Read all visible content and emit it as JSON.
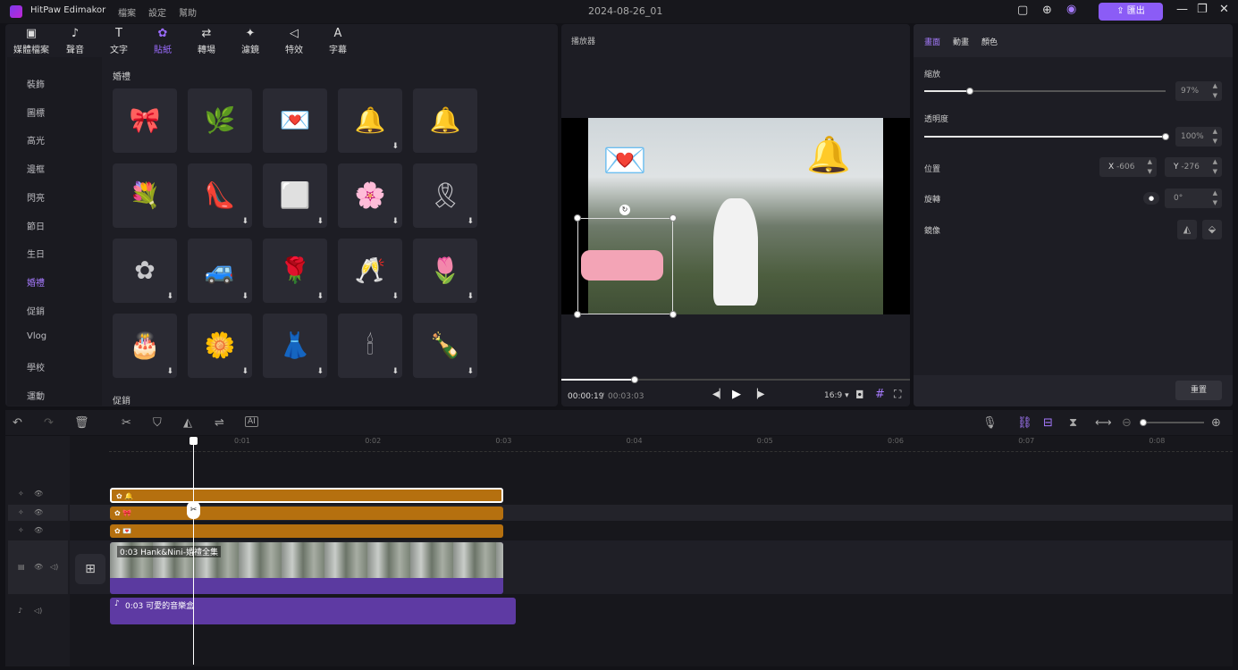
{
  "app": {
    "title": "HitPaw Edimakor",
    "project_date": "2024-08-26_01",
    "export_label": "匯出"
  },
  "menu": [
    "檔案",
    "設定",
    "幫助"
  ],
  "toolbar_tabs": [
    {
      "label": "媒體檔案",
      "icon": "media-icon"
    },
    {
      "label": "聲音",
      "icon": "music-note-icon"
    },
    {
      "label": "文字",
      "icon": "text-icon"
    },
    {
      "label": "貼紙",
      "icon": "sticker-icon",
      "active": true
    },
    {
      "label": "轉場",
      "icon": "transition-icon"
    },
    {
      "label": "濾鏡",
      "icon": "filter-icon"
    },
    {
      "label": "特效",
      "icon": "effects-icon"
    },
    {
      "label": "字幕",
      "icon": "subtitle-icon"
    }
  ],
  "categories": [
    "裝飾",
    "圖標",
    "高光",
    "邊框",
    "閃亮",
    "節日",
    "生日",
    "婚禮",
    "促銷",
    "Vlog",
    "學校",
    "運動"
  ],
  "active_category": "婚禮",
  "sticker_section_title": "婚禮",
  "next_section_title": "促銷",
  "stickers": [
    {
      "name": "floral-banner",
      "glyph": "🎀",
      "download": false
    },
    {
      "name": "floral-wreath",
      "glyph": "🌿",
      "download": false
    },
    {
      "name": "love-letters",
      "glyph": "💌",
      "download": false
    },
    {
      "name": "pink-bells",
      "glyph": "🔔",
      "download": true
    },
    {
      "name": "golden-bells",
      "glyph": "🔔",
      "download": false
    },
    {
      "name": "bouquet",
      "glyph": "💐",
      "download": false
    },
    {
      "name": "pink-heels",
      "glyph": "👠",
      "download": true
    },
    {
      "name": "white-card",
      "glyph": "⬜",
      "download": true
    },
    {
      "name": "pink-floral-banner",
      "glyph": "🌸",
      "download": true
    },
    {
      "name": "wedding-ribbon",
      "glyph": "🎗",
      "download": true
    },
    {
      "name": "white-flowers",
      "glyph": "✿",
      "download": true
    },
    {
      "name": "wedding-car",
      "glyph": "🚙",
      "download": true
    },
    {
      "name": "pink-roses",
      "glyph": "🌹",
      "download": true
    },
    {
      "name": "champagne-toast",
      "glyph": "🥂",
      "download": true
    },
    {
      "name": "single-rose",
      "glyph": "🌷",
      "download": true
    },
    {
      "name": "wedding-cake",
      "glyph": "🎂",
      "download": true
    },
    {
      "name": "white-rose",
      "glyph": "🌼",
      "download": true
    },
    {
      "name": "wedding-dress",
      "glyph": "👗",
      "download": true
    },
    {
      "name": "candle-flowers",
      "glyph": "🕯",
      "download": true
    },
    {
      "name": "champagne-bottle",
      "glyph": "🍾",
      "download": true
    }
  ],
  "player": {
    "title": "播放器",
    "current_time": "00:00:19",
    "separator": "/",
    "total_time": "00:03:03",
    "aspect": "16:9",
    "progress_fraction": 0.21
  },
  "props": {
    "tabs": [
      "畫面",
      "動畫",
      "顏色"
    ],
    "active_tab": "畫面",
    "scale_label": "縮放",
    "scale_value": "97%",
    "scale_fraction": 0.19,
    "opacity_label": "透明度",
    "opacity_value": "100%",
    "opacity_fraction": 1.0,
    "position_label": "位置",
    "pos_x_label": "X",
    "pos_x": "-606",
    "pos_y_label": "Y",
    "pos_y": "-276",
    "rotate_label": "旋轉",
    "rotate_value": "0°",
    "mirror_label": "鏡像",
    "reset_label": "重置"
  },
  "timeline": {
    "ruler": [
      "0:01",
      "0:02",
      "0:03",
      "0:04",
      "0:05",
      "0:06",
      "0:07",
      "0:08"
    ],
    "video_clip_label": "0:03 Hank&Nini-婚禮全集",
    "audio_clip_label": "0:03 可愛的音樂盒"
  },
  "colors": {
    "accent": "#8b5cf6",
    "sticker_clip": "#b5700f",
    "video_clip": "#5b3aa0",
    "audio_clip": "#5e3aa3"
  }
}
